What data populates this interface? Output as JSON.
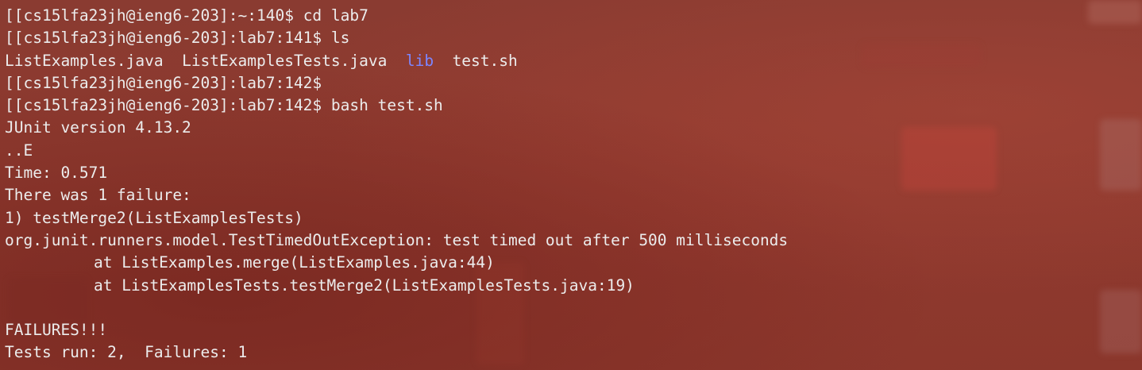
{
  "terminal": {
    "lines": [
      {
        "prompt": "[[cs15lfa23jh@ieng6-203]:~:140$ ",
        "cmd": "cd lab7"
      },
      {
        "prompt": "[[cs15lfa23jh@ieng6-203]:lab7:141$ ",
        "cmd": "ls"
      },
      {
        "files": {
          "file1": "ListExamples.java",
          "file2": "ListExamplesTests.java",
          "dir": "lib",
          "file3": "test.sh"
        }
      },
      {
        "prompt": "[[cs15lfa23jh@ieng6-203]:lab7:142$",
        "cmd": ""
      },
      {
        "prompt": "[[cs15lfa23jh@ieng6-203]:lab7:142$ ",
        "cmd": "bash test.sh"
      },
      {
        "text": "JUnit version 4.13.2"
      },
      {
        "text": "..E"
      },
      {
        "text": "Time: 0.571"
      },
      {
        "text": "There was 1 failure:"
      },
      {
        "text": "1) testMerge2(ListExamplesTests)"
      },
      {
        "text": "org.junit.runners.model.TestTimedOutException: test timed out after 500 milliseconds"
      },
      {
        "text": "at ListExamples.merge(ListExamples.java:44)"
      },
      {
        "text": "at ListExamplesTests.testMerge2(ListExamplesTests.java:19)"
      },
      {
        "text": ""
      },
      {
        "text": "FAILURES!!!"
      },
      {
        "text": "Tests run: 2,  Failures: 1"
      }
    ]
  },
  "colors": {
    "background": "#8c3a30",
    "text": "#ececec",
    "directory": "#7c86ff"
  }
}
